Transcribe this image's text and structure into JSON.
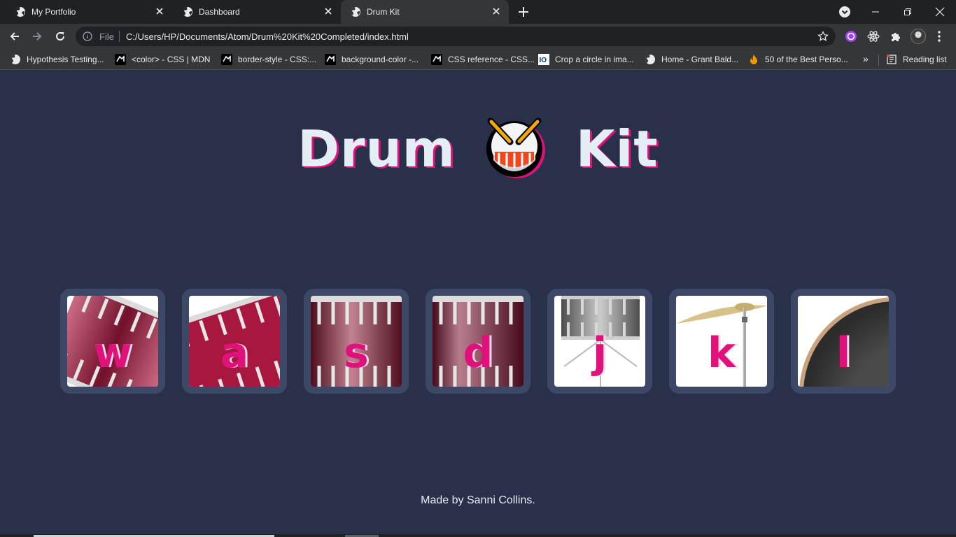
{
  "browser": {
    "tabs": [
      {
        "title": "My Portfolio",
        "active": false
      },
      {
        "title": "Dashboard",
        "active": false
      },
      {
        "title": "Drum Kit",
        "active": true
      }
    ],
    "address": {
      "scheme_label": "File",
      "url": "C:/Users/HP/Documents/Atom/Drum%20Kit%20Completed/index.html"
    },
    "bookmarks": [
      {
        "label": "Hypothesis Testing...",
        "icon": "globe-icon"
      },
      {
        "label": "<color> - CSS | MDN",
        "icon": "mdn-icon"
      },
      {
        "label": "border-style - CSS:...",
        "icon": "mdn-icon"
      },
      {
        "label": "background-color -...",
        "icon": "mdn-icon"
      },
      {
        "label": "CSS reference - CSS...",
        "icon": "mdn-icon"
      },
      {
        "label": "Crop a circle in ima...",
        "icon": "io-icon"
      },
      {
        "label": "Home - Grant Bald...",
        "icon": "globe-icon"
      },
      {
        "label": "50 of the Best Perso...",
        "icon": "flame-icon"
      }
    ],
    "more_bookmarks": "»",
    "reading_list": "Reading list"
  },
  "page": {
    "title_left": "Drum",
    "title_right": "Kit",
    "title_color": "#e4eef5",
    "accent": "#e0117a",
    "background": "#283149",
    "drums": [
      {
        "key": "w",
        "image": "tom-1"
      },
      {
        "key": "a",
        "image": "tom-2"
      },
      {
        "key": "s",
        "image": "tom-3"
      },
      {
        "key": "d",
        "image": "tom-4"
      },
      {
        "key": "j",
        "image": "snare"
      },
      {
        "key": "k",
        "image": "crash"
      },
      {
        "key": "l",
        "image": "kick"
      }
    ],
    "footer": "Made by Sanni Collins."
  }
}
